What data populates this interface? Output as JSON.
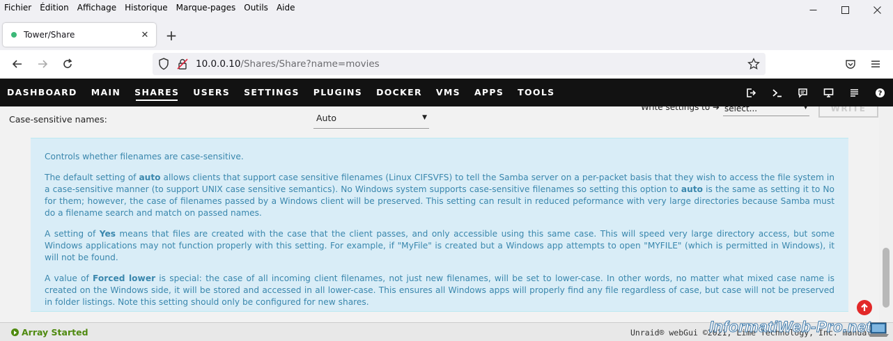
{
  "browser": {
    "menu": [
      "Fichier",
      "Édition",
      "Affichage",
      "Historique",
      "Marque-pages",
      "Outils",
      "Aide"
    ],
    "tab_title": "Tower/Share",
    "url_host": "10.0.0.10",
    "url_path": "/Shares/Share?name=movies",
    "icons": [
      "minimize-icon",
      "maximize-icon",
      "close-icon",
      "back-icon",
      "forward-icon",
      "reload-icon",
      "shield-icon",
      "lock-icon",
      "star-icon",
      "pocket-icon",
      "menu-icon"
    ]
  },
  "unraid": {
    "nav": [
      "DASHBOARD",
      "MAIN",
      "SHARES",
      "USERS",
      "SETTINGS",
      "PLUGINS",
      "DOCKER",
      "VMS",
      "APPS",
      "TOOLS"
    ],
    "active_nav": "SHARES",
    "header_icons": [
      "logout-icon",
      "terminal-icon",
      "feedback-icon",
      "monitor-icon",
      "log-icon",
      "help-icon"
    ]
  },
  "form": {
    "case_label": "Case-sensitive names:",
    "case_value": "Auto",
    "write_label": "Write settings to",
    "write_value": "select...",
    "write_button": "WRITE"
  },
  "help": {
    "p1": "Controls whether filenames are case-sensitive.",
    "p2_a": "The default setting of ",
    "p2_b1": "auto",
    "p2_c": " allows clients that support case sensitive filenames (Linux CIFSVFS) to tell the Samba server on a per-packet basis that they wish to access the file system in a case-sensitive manner (to support UNIX case sensitive semantics). No Windows system supports case-sensitive filenames so setting this option to ",
    "p2_b2": "auto",
    "p2_d": " is the same as setting it to No for them; however, the case of filenames passed by a Windows client will be preserved. This setting can result in reduced peformance with very large directories because Samba must do a filename search and match on passed names.",
    "p3_a": "A setting of ",
    "p3_b": "Yes",
    "p3_c": " means that files are created with the case that the client passes, and only accessible using this same case. This will speed very large directory access, but some Windows applications may not function properly with this setting. For example, if \"MyFile\" is created but a Windows app attempts to open \"MYFILE\" (which is permitted in Windows), it will not be found.",
    "p4_a": "A value of ",
    "p4_b": "Forced lower",
    "p4_c": " is special: the case of all incoming client filenames, not just new filenames, will be set to lower-case. In other words, no matter what mixed case name is created on the Windows side, it will be stored and accessed in all lower-case. This ensures all Windows apps will properly find any file regardless of case, but case will not be preserved in folder listings. Note this setting should only be configured for new shares."
  },
  "footer": {
    "array_status": "Array Started",
    "copyright": "Unraid® webGui ©2021, Lime Technology, Inc. manual",
    "watermark": "InformatiWeb-Pro.net"
  },
  "colors": {
    "header_bg": "#121212",
    "help_bg": "#d9edf7",
    "help_text": "#3a87ad",
    "status_green": "#4f8a10",
    "scroll_top_red": "#e22828"
  }
}
